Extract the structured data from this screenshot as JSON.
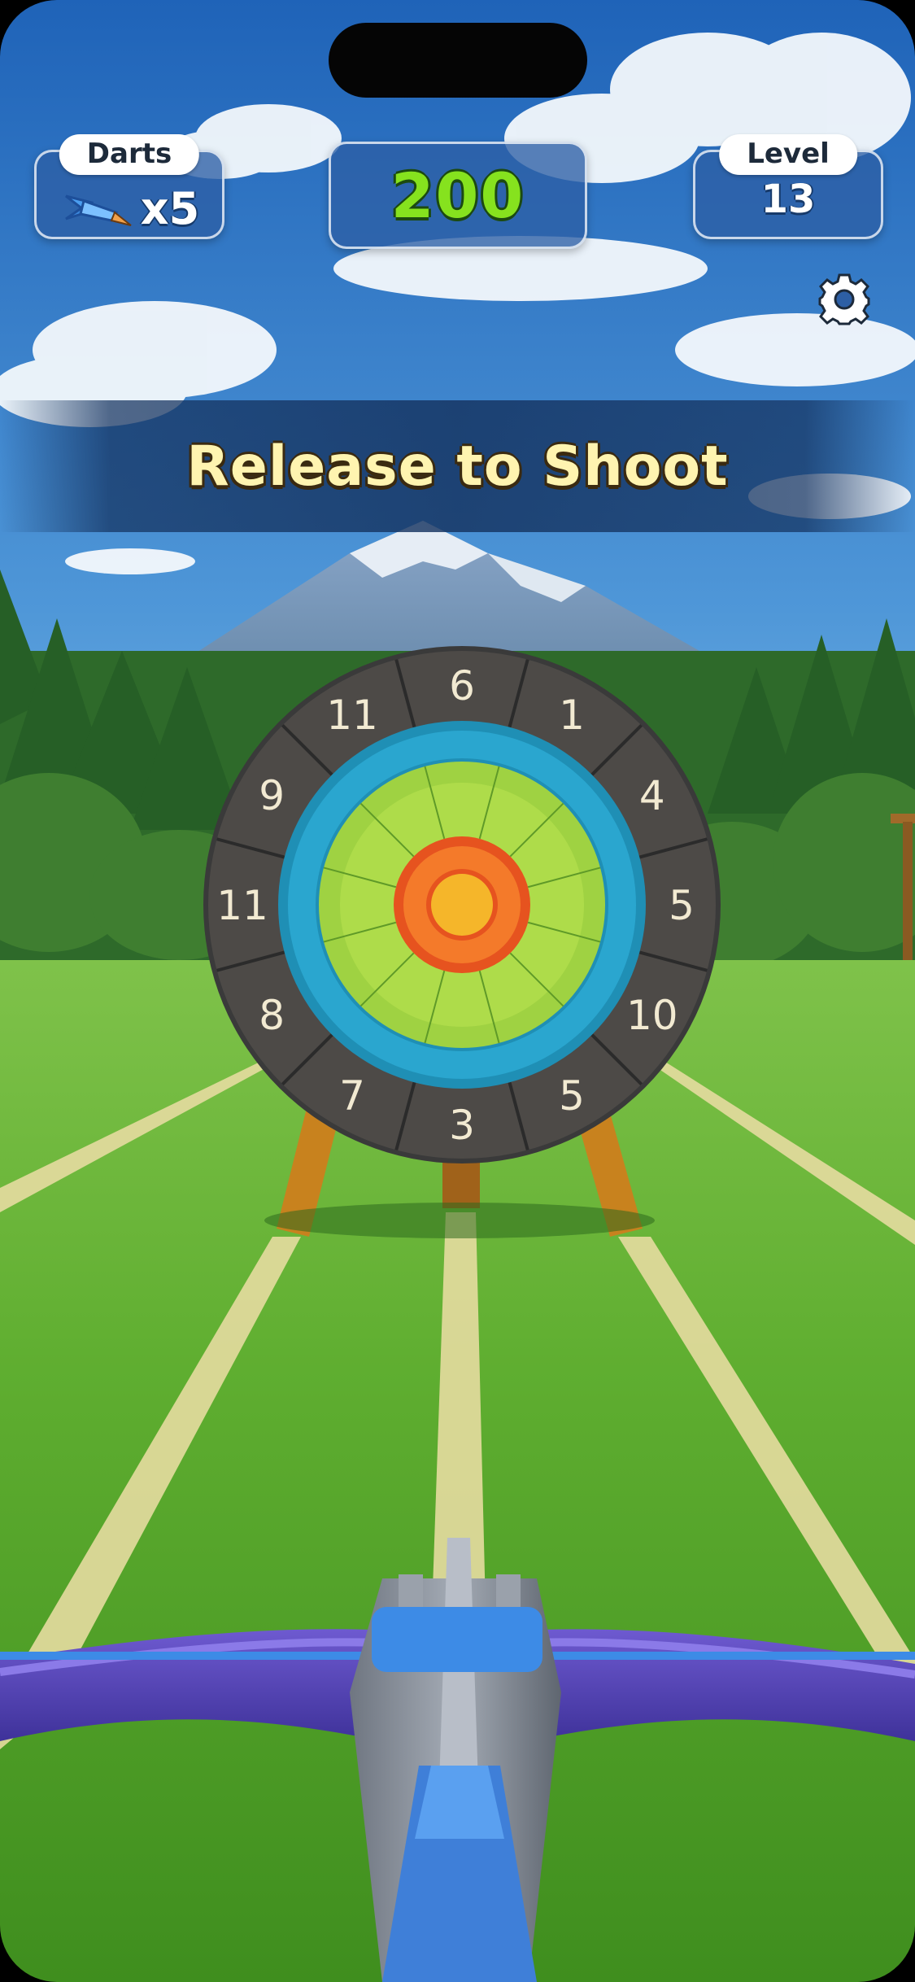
{
  "hud": {
    "darts_label": "Darts",
    "darts_count": "x5",
    "score": "200",
    "level_label": "Level",
    "level_value": "13"
  },
  "banner": {
    "text": "Release to Shoot"
  },
  "target": {
    "ring_numbers": [
      "6",
      "1",
      "4",
      "5",
      "10",
      "5",
      "3",
      "7",
      "8",
      "11",
      "9",
      "11"
    ]
  },
  "icons": {
    "settings": "gear-icon",
    "darts": "dart-icon"
  },
  "colors": {
    "score_green": "#86e21e",
    "panel_blue": "#2d5fa5",
    "banner_text": "#fff4b0"
  }
}
